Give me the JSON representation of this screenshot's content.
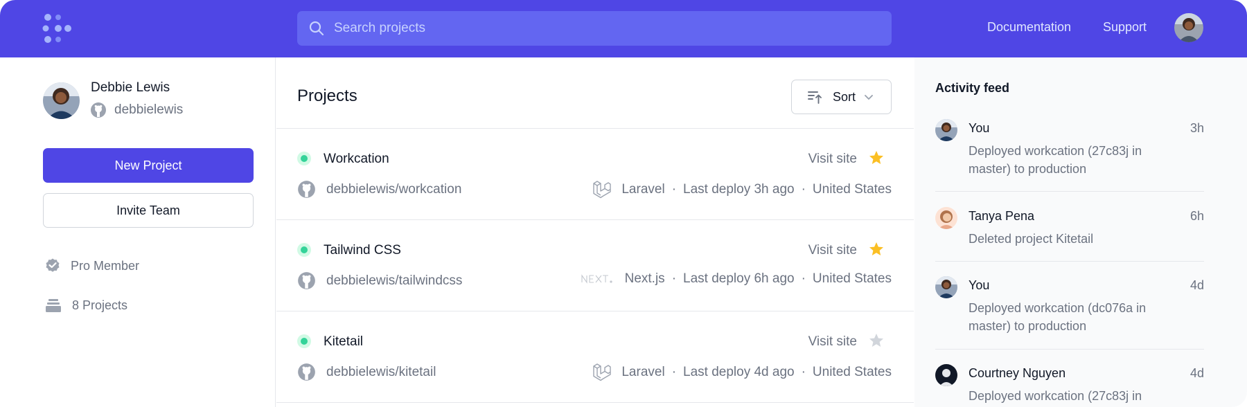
{
  "topbar": {
    "logo_icon": "brand-dots-logo",
    "search_placeholder": "Search projects",
    "links": [
      "Documentation",
      "Support"
    ]
  },
  "profile": {
    "name": "Debbie Lewis",
    "github_handle": "debbielewis",
    "new_project_label": "New Project",
    "invite_team_label": "Invite Team",
    "membership": "Pro Member",
    "project_count": "8 Projects"
  },
  "projects_panel": {
    "title": "Projects",
    "sort_label": "Sort",
    "items": [
      {
        "name": "Workcation",
        "repo": "debbielewis/workcation",
        "visit_label": "Visit site",
        "starred": true,
        "framework": "Laravel",
        "framework_icon": "laravel-icon",
        "last_deploy": "Last deploy 3h ago",
        "location": "United States"
      },
      {
        "name": "Tailwind CSS",
        "repo": "debbielewis/tailwindcss",
        "visit_label": "Visit site",
        "starred": true,
        "framework": "Next.js",
        "framework_icon": "nextjs-icon",
        "last_deploy": "Last deploy 6h ago",
        "location": "United States"
      },
      {
        "name": "Kitetail",
        "repo": "debbielewis/kitetail",
        "visit_label": "Visit site",
        "starred": false,
        "framework": "Laravel",
        "framework_icon": "laravel-icon",
        "last_deploy": "Last deploy 4d ago",
        "location": "United States"
      }
    ]
  },
  "activity_feed": {
    "title": "Activity feed",
    "items": [
      {
        "name": "You",
        "time": "3h",
        "text": "Deployed workcation (27c83j in master) to production"
      },
      {
        "name": "Tanya Pena",
        "time": "6h",
        "text": "Deleted project Kitetail"
      },
      {
        "name": "You",
        "time": "4d",
        "text": "Deployed workcation (dc076a in master) to production"
      },
      {
        "name": "Courtney Nguyen",
        "time": "4d",
        "text": "Deployed workcation (27c83j in"
      }
    ]
  },
  "colors": {
    "brand": "#4f46e5",
    "search_bg": "#6366f1",
    "status_green": "#34d399",
    "star_active": "#fbbf24",
    "star_inactive": "#d1d5db"
  }
}
